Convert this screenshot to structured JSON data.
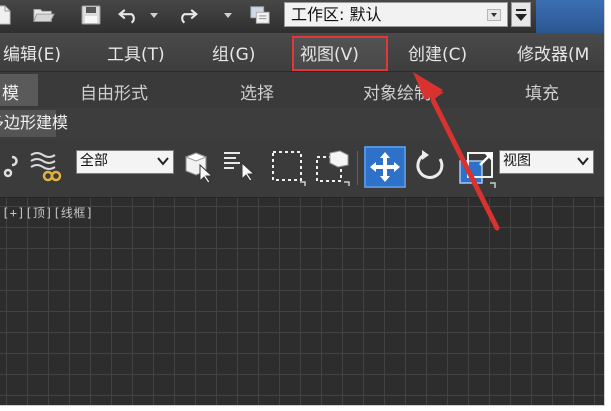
{
  "toolbar_quick": {
    "icons": [
      "new-file-icon",
      "open-folder-icon",
      "save-icon",
      "undo-icon",
      "undo-dropdown-icon",
      "redo-icon",
      "redo-dropdown-icon",
      "project-folder-icon"
    ],
    "workspace_label": "工作区: 默认"
  },
  "menubar": {
    "items": [
      "编辑(E)",
      "工具(T)",
      "组(G)",
      "视图(V)",
      "创建(C)",
      "修改器(M"
    ],
    "highlighted": "视图(V)",
    "highlight_color": "#e2373a"
  },
  "ribbon_tabs": {
    "items": [
      "模",
      "自由形式",
      "选择",
      "对象绘制",
      "填充"
    ],
    "active": "模"
  },
  "subpanel": {
    "label": "多边形建模"
  },
  "main_toolbar": {
    "selection_filter": "全部",
    "reference_coord": "视图"
  },
  "viewport": {
    "label": "[+][顶][线框]",
    "grid_color": "#434343",
    "background_color": "#2d2d2d"
  },
  "annotation": {
    "arrow_color": "#d9322f"
  },
  "colors": {
    "accent_blue": "#2e71c9",
    "title_blue": "#3b6fb3"
  }
}
